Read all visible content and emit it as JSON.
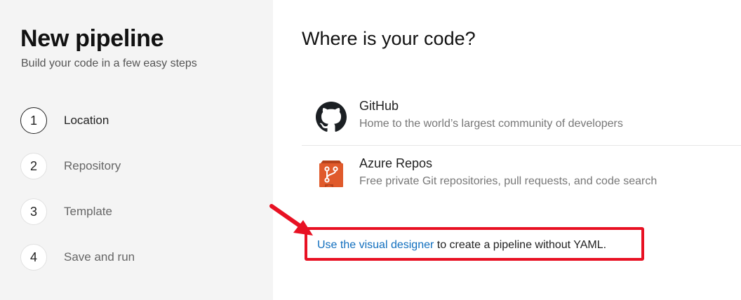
{
  "wizard": {
    "title": "New pipeline",
    "subtitle": "Build your code in a few easy steps",
    "steps": [
      {
        "number": "1",
        "label": "Location",
        "active": true
      },
      {
        "number": "2",
        "label": "Repository",
        "active": false
      },
      {
        "number": "3",
        "label": "Template",
        "active": false
      },
      {
        "number": "4",
        "label": "Save and run",
        "active": false
      }
    ]
  },
  "main": {
    "title": "Where is your code?",
    "sources": [
      {
        "name": "GitHub",
        "description": "Home to the world’s largest community of developers",
        "icon": "github-icon"
      },
      {
        "name": "Azure Repos",
        "description": "Free private Git repositories, pull requests, and code search",
        "icon": "azure-repos-icon"
      }
    ],
    "visual_designer": {
      "link_text": "Use the visual designer",
      "trailing_text": " to create a pipeline without YAML."
    }
  },
  "colors": {
    "left_panel_bg": "#f4f4f4",
    "link": "#106ebe",
    "highlight": "#e81123",
    "azure_repos_orange": "#e05a2b"
  }
}
